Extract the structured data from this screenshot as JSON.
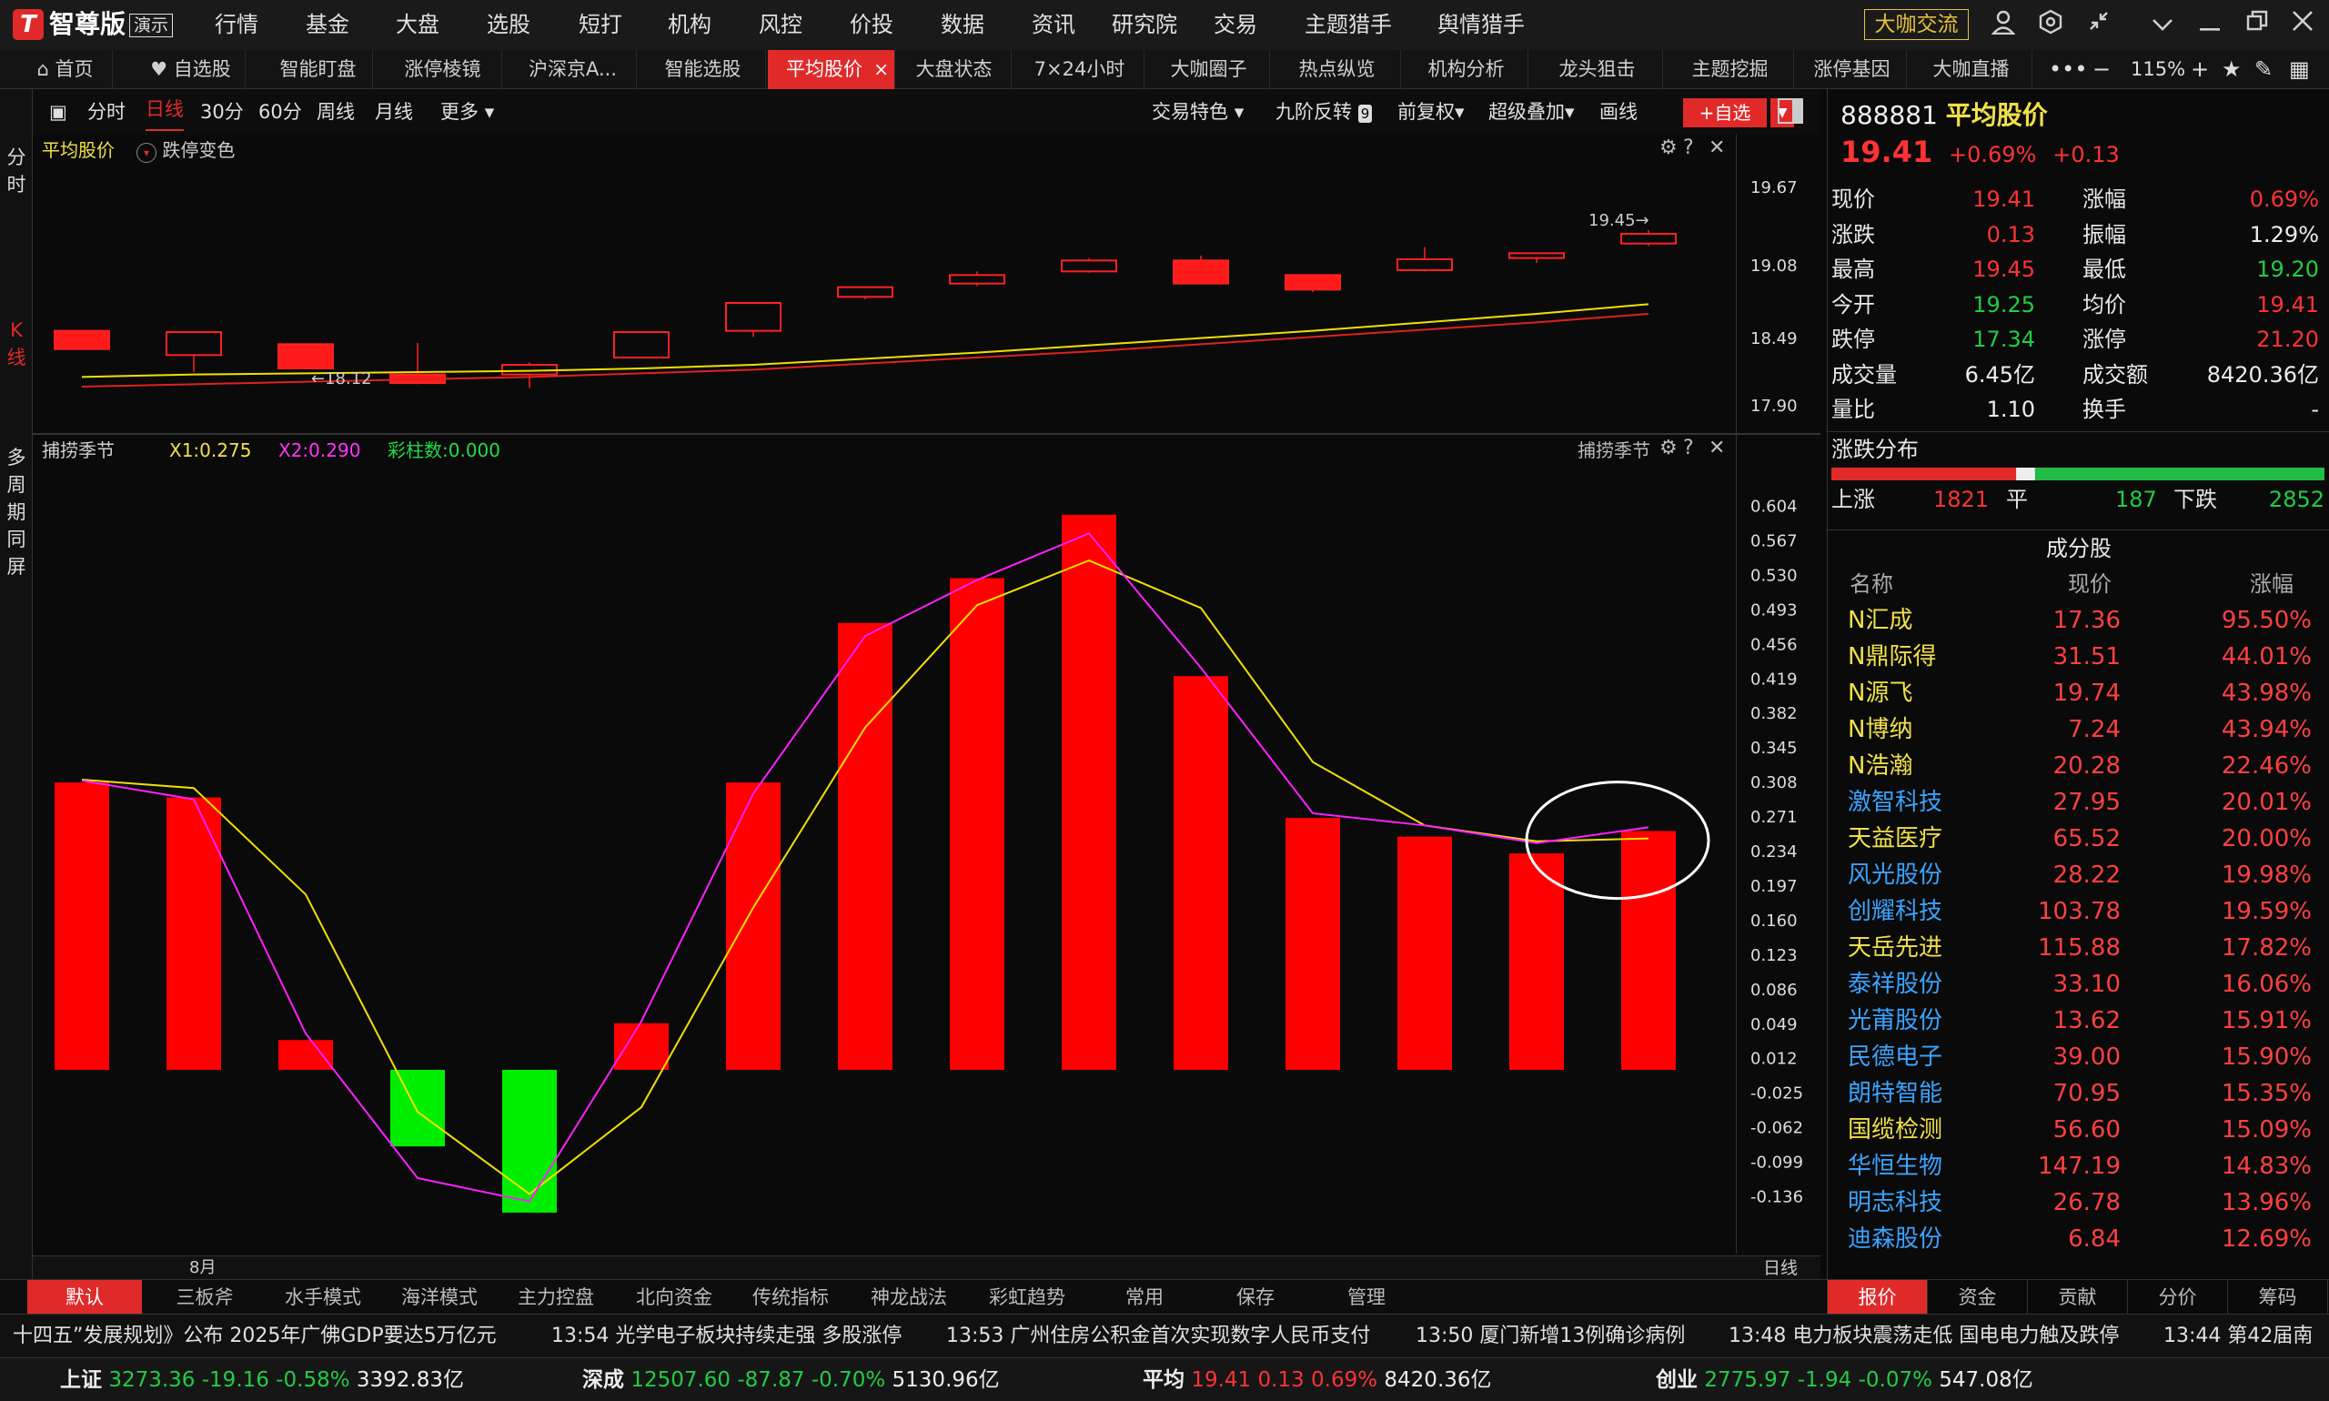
{
  "app": {
    "brand": "智尊版",
    "brand_tag": "演示",
    "menu": [
      "行情",
      "基金",
      "大盘",
      "选股",
      "短打",
      "机构",
      "风控",
      "价投",
      "数据",
      "资讯",
      "研究院",
      "交易",
      "主题猎手",
      "舆情猎手"
    ],
    "daka_btn": "大咖交流"
  },
  "tabs": [
    {
      "label": "首页",
      "icon": "home-icon"
    },
    {
      "label": "自选股",
      "icon": "heart-icon"
    },
    {
      "label": "智能盯盘"
    },
    {
      "label": "涨停棱镜"
    },
    {
      "label": "沪深京A..."
    },
    {
      "label": "智能选股"
    },
    {
      "label": "平均股价",
      "active": true
    },
    {
      "label": "大盘状态"
    },
    {
      "label": "7×24小时"
    },
    {
      "label": "大咖圈子"
    },
    {
      "label": "热点纵览"
    },
    {
      "label": "机构分析"
    },
    {
      "label": "龙头狙击"
    },
    {
      "label": "主题挖掘"
    },
    {
      "label": "涨停基因"
    },
    {
      "label": "大咖直播"
    }
  ],
  "zoom": "115%",
  "left_strip": {
    "fenshi": [
      "分",
      "时"
    ],
    "kxian": [
      "K",
      "线"
    ],
    "multi": [
      "多",
      "周",
      "期",
      "同",
      "屏"
    ]
  },
  "chart_toolbar": {
    "periods": [
      "分时",
      "日线",
      "30分",
      "60分",
      "周线",
      "月线",
      "更多"
    ],
    "active_period": "日线",
    "options": [
      "交易特色",
      "九阶反转",
      "前复权",
      "超级叠加",
      "画线"
    ],
    "nine_badge": "9",
    "add_btn": "+自选"
  },
  "candle_panel": {
    "title": "平均股价",
    "sub": "跌停变色",
    "yticks": [
      "19.67",
      "19.08",
      "18.49",
      "17.90"
    ],
    "hi_label": "19.45→",
    "lo_label": "←18.12"
  },
  "candles": [
    {
      "o": 18.48,
      "c": 18.33,
      "h": 18.48,
      "l": 18.33
    },
    {
      "o": 18.28,
      "c": 18.47,
      "h": 18.47,
      "l": 18.14
    },
    {
      "o": 18.37,
      "c": 18.17,
      "h": 18.37,
      "l": 18.17
    },
    {
      "o": 18.12,
      "c": 18.05,
      "h": 18.38,
      "l": 18.04
    },
    {
      "o": 18.12,
      "c": 18.2,
      "h": 18.22,
      "l": 18.01
    },
    {
      "o": 18.26,
      "c": 18.47,
      "h": 18.47,
      "l": 18.26
    },
    {
      "o": 18.48,
      "c": 18.71,
      "h": 18.71,
      "l": 18.43
    },
    {
      "o": 18.76,
      "c": 18.84,
      "h": 18.84,
      "l": 18.74
    },
    {
      "o": 18.87,
      "c": 18.94,
      "h": 18.97,
      "l": 18.85
    },
    {
      "o": 18.97,
      "c": 19.06,
      "h": 19.08,
      "l": 18.96
    },
    {
      "o": 19.06,
      "c": 18.87,
      "h": 19.1,
      "l": 18.87
    },
    {
      "o": 18.94,
      "c": 18.82,
      "h": 18.94,
      "l": 18.8
    },
    {
      "o": 18.98,
      "c": 19.07,
      "h": 19.17,
      "l": 18.97
    },
    {
      "o": 19.08,
      "c": 19.12,
      "h": 19.12,
      "l": 19.04
    },
    {
      "o": 19.2,
      "c": 19.28,
      "h": 19.31,
      "l": 19.18
    }
  ],
  "ma": {
    "yellow": [
      18.1,
      18.12,
      18.13,
      18.14,
      18.15,
      18.17,
      18.2,
      18.25,
      18.3,
      18.36,
      18.42,
      18.48,
      18.55,
      18.62,
      18.7
    ],
    "red": [
      18.02,
      18.04,
      18.06,
      18.08,
      18.1,
      18.13,
      18.16,
      18.21,
      18.26,
      18.31,
      18.37,
      18.43,
      18.49,
      18.55,
      18.62
    ]
  },
  "chart_data": {
    "type": "bar",
    "title": "捕捞季节",
    "x1_label": "X1:0.275",
    "x2_label": "X2:0.290",
    "color_label": "彩柱数:0.000",
    "yticks": [
      "0.604",
      "0.567",
      "0.530",
      "0.493",
      "0.456",
      "0.419",
      "0.382",
      "0.345",
      "0.308",
      "0.271",
      "0.234",
      "0.197",
      "0.160",
      "0.123",
      "0.086",
      "0.049",
      "0.012",
      "-0.025",
      "-0.062",
      "-0.099",
      "-0.136"
    ],
    "ylim": [
      -0.155,
      0.625
    ],
    "bars": [
      0.308,
      0.292,
      0.032,
      -0.082,
      -0.153,
      0.05,
      0.308,
      0.479,
      0.527,
      0.595,
      0.422,
      0.27,
      0.25,
      0.232,
      0.256
    ],
    "x1": [
      0.311,
      0.302,
      0.188,
      -0.045,
      -0.133,
      -0.04,
      0.174,
      0.367,
      0.498,
      0.546,
      0.495,
      0.33,
      0.262,
      0.245,
      0.248
    ],
    "x2": [
      0.31,
      0.29,
      0.039,
      -0.116,
      -0.141,
      0.052,
      0.296,
      0.465,
      0.525,
      0.575,
      0.431,
      0.275,
      0.262,
      0.243,
      0.26
    ],
    "x_label": "8月",
    "corner_label": "日线"
  },
  "modes": [
    "默认",
    "三板斧",
    "水手模式",
    "海洋模式",
    "主力控盘",
    "北向资金",
    "传统指标",
    "神龙战法",
    "彩虹趋势",
    "常用",
    "保存",
    "管理"
  ],
  "stock": {
    "code": "888881",
    "name": "平均股价",
    "price": "19.41",
    "change_pct": "+0.69%",
    "change": "+0.13"
  },
  "quote": [
    {
      "l": "现价",
      "v": "19.41",
      "l2": "涨幅",
      "v2": "0.69%",
      "c": "up",
      "c2": "up"
    },
    {
      "l": "涨跌",
      "v": "0.13",
      "l2": "振幅",
      "v2": "1.29%",
      "c": "up",
      "c2": "wh"
    },
    {
      "l": "最高",
      "v": "19.45",
      "l2": "最低",
      "v2": "19.20",
      "c": "up",
      "c2": "dn"
    },
    {
      "l": "今开",
      "v": "19.25",
      "l2": "均价",
      "v2": "19.41",
      "c": "dn",
      "c2": "up"
    },
    {
      "l": "跌停",
      "v": "17.34",
      "l2": "涨停",
      "v2": "21.20",
      "c": "dn",
      "c2": "up"
    },
    {
      "l": "成交量",
      "v": "6.45亿",
      "l2": "成交额",
      "v2": "8420.36亿",
      "c": "wh",
      "c2": "wh"
    },
    {
      "l": "量比",
      "v": "1.10",
      "l2": "换手",
      "v2": "-",
      "c": "wh",
      "c2": "wh"
    }
  ],
  "dist": {
    "title": "涨跌分布",
    "up_label": "上涨",
    "up": "1821",
    "flat_label": "平",
    "flat": "187",
    "down_label": "下跌",
    "down": "2852",
    "up_n": 1821,
    "flat_n": 187,
    "down_n": 2852
  },
  "constituents": {
    "title": "成分股",
    "headers": [
      "名称",
      "现价",
      "涨幅"
    ],
    "rows": [
      {
        "name": "N汇成",
        "price": "17.36",
        "chg": "95.50%",
        "c": "yl"
      },
      {
        "name": "N鼎际得",
        "price": "31.51",
        "chg": "44.01%",
        "c": "yl"
      },
      {
        "name": "N源飞",
        "price": "19.74",
        "chg": "43.98%",
        "c": "yl"
      },
      {
        "name": "N博纳",
        "price": "7.24",
        "chg": "43.94%",
        "c": "yl"
      },
      {
        "name": "N浩瀚",
        "price": "20.28",
        "chg": "22.46%",
        "c": "yl"
      },
      {
        "name": "激智科技",
        "price": "27.95",
        "chg": "20.01%",
        "c": "bl"
      },
      {
        "name": "天益医疗",
        "price": "65.52",
        "chg": "20.00%",
        "c": "yl"
      },
      {
        "name": "风光股份",
        "price": "28.22",
        "chg": "19.98%",
        "c": "bl"
      },
      {
        "name": "创耀科技",
        "price": "103.78",
        "chg": "19.59%",
        "c": "bl"
      },
      {
        "name": "天岳先进",
        "price": "115.88",
        "chg": "17.82%",
        "c": "yl"
      },
      {
        "name": "泰祥股份",
        "price": "33.10",
        "chg": "16.06%",
        "c": "bl"
      },
      {
        "name": "光莆股份",
        "price": "13.62",
        "chg": "15.91%",
        "c": "bl"
      },
      {
        "name": "民德电子",
        "price": "39.00",
        "chg": "15.90%",
        "c": "bl"
      },
      {
        "name": "朗特智能",
        "price": "70.95",
        "chg": "15.35%",
        "c": "bl"
      },
      {
        "name": "国缆检测",
        "price": "56.60",
        "chg": "15.09%",
        "c": "yl"
      },
      {
        "name": "华恒生物",
        "price": "147.19",
        "chg": "14.83%",
        "c": "bl"
      },
      {
        "name": "明志科技",
        "price": "26.78",
        "chg": "13.96%",
        "c": "bl"
      },
      {
        "name": "迪森股份",
        "price": "6.84",
        "chg": "12.69%",
        "c": "bl"
      }
    ]
  },
  "right_tabs": [
    "报价",
    "资金",
    "贡献",
    "分价",
    "筹码"
  ],
  "news": [
    "十四五”发展规划》公布 2025年广佛GDP要达5万亿元",
    "13:54 光学电子板块持续走强 多股涨停",
    "13:53 广州住房公积金首次实现数字人民币支付",
    "13:50 厦门新增13例确诊病例",
    "13:48 电力板块震荡走低 国电电力触及跌停",
    "13:44 第42届南"
  ],
  "indices": [
    {
      "name": "上证",
      "val": "3273.36",
      "chg": "-19.16",
      "pct": "-0.58%",
      "amt": "3392.83亿",
      "c": "dn"
    },
    {
      "name": "深成",
      "val": "12507.60",
      "chg": "-87.87",
      "pct": "-0.70%",
      "amt": "5130.96亿",
      "c": "dn"
    },
    {
      "name": "平均",
      "val": "19.41",
      "chg": "0.13",
      "pct": "0.69%",
      "amt": "8420.36亿",
      "c": "up"
    },
    {
      "name": "创业",
      "val": "2775.97",
      "chg": "-1.94",
      "pct": "-0.07%",
      "amt": "547.08亿",
      "c": "dn"
    }
  ]
}
